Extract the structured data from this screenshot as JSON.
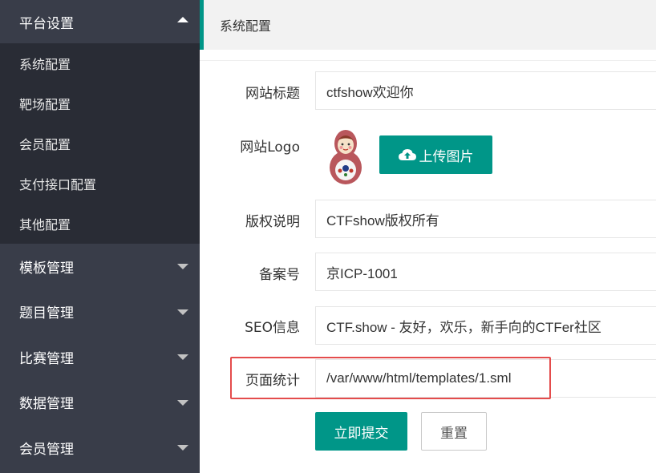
{
  "sidebar": {
    "header": "平台设置",
    "sub_items": [
      "系统配置",
      "靶场配置",
      "会员配置",
      "支付接口配置",
      "其他配置"
    ],
    "items": [
      "模板管理",
      "题目管理",
      "比赛管理",
      "数据管理",
      "会员管理"
    ]
  },
  "main": {
    "title": "系统配置",
    "form": {
      "site_title_label": "网站标题",
      "site_title_value": "ctfshow欢迎你",
      "logo_label": "网站Logo",
      "upload_label": "上传图片",
      "copyright_label": "版权说明",
      "copyright_value": "CTFshow版权所有",
      "icp_label": "备案号",
      "icp_value": "京ICP-1001",
      "seo_label": "SEO信息",
      "seo_value": "CTF.show - 友好，欢乐，新手向的CTFer社区",
      "stats_label": "页面统计",
      "stats_value": "/var/www/html/templates/1.sml",
      "submit_label": "立即提交",
      "reset_label": "重置"
    }
  },
  "colors": {
    "accent": "#009688",
    "sidebar_bg": "#393d49",
    "subnav_bg": "#292c35",
    "highlight": "#e44c4c"
  }
}
